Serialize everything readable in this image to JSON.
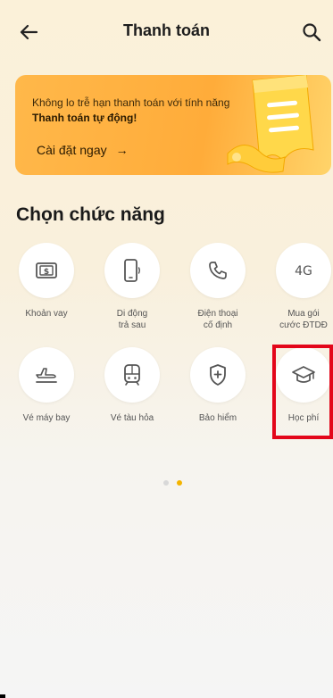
{
  "header": {
    "title": "Thanh toán",
    "back_icon": "arrow-left-icon",
    "search_icon": "search-icon"
  },
  "banner": {
    "text_prefix": "Không lo trễ hạn thanh toán với tính năng ",
    "text_bold": "Thanh toán tự động!",
    "cta_label": "Cài đặt ngay",
    "cta_arrow": "→",
    "art_icon": "receipt-icon",
    "colors": {
      "background": "#ffb84a",
      "receipt": "#ffd84a"
    }
  },
  "section": {
    "title": "Chọn chức năng"
  },
  "features": [
    {
      "label": "Khoản vay",
      "icon": "dollar-bill-icon"
    },
    {
      "label": "Di động\ntrả sau",
      "icon": "mobile-phone-icon"
    },
    {
      "label": "Điện thoại\ncố định",
      "icon": "telephone-icon"
    },
    {
      "label": "Mua gói\ncước ĐTDĐ",
      "icon": "4g-icon"
    },
    {
      "label": "Vé máy bay",
      "icon": "airplane-icon"
    },
    {
      "label": "Vé tàu hỏa",
      "icon": "train-icon"
    },
    {
      "label": "Bảo hiểm",
      "icon": "shield-plus-icon"
    },
    {
      "label": "Học phí",
      "icon": "graduation-cap-icon"
    }
  ],
  "pagination": {
    "total": 2,
    "active_index": 1
  },
  "colors": {
    "accent": "#f4b400",
    "highlight": "#e3061a"
  }
}
